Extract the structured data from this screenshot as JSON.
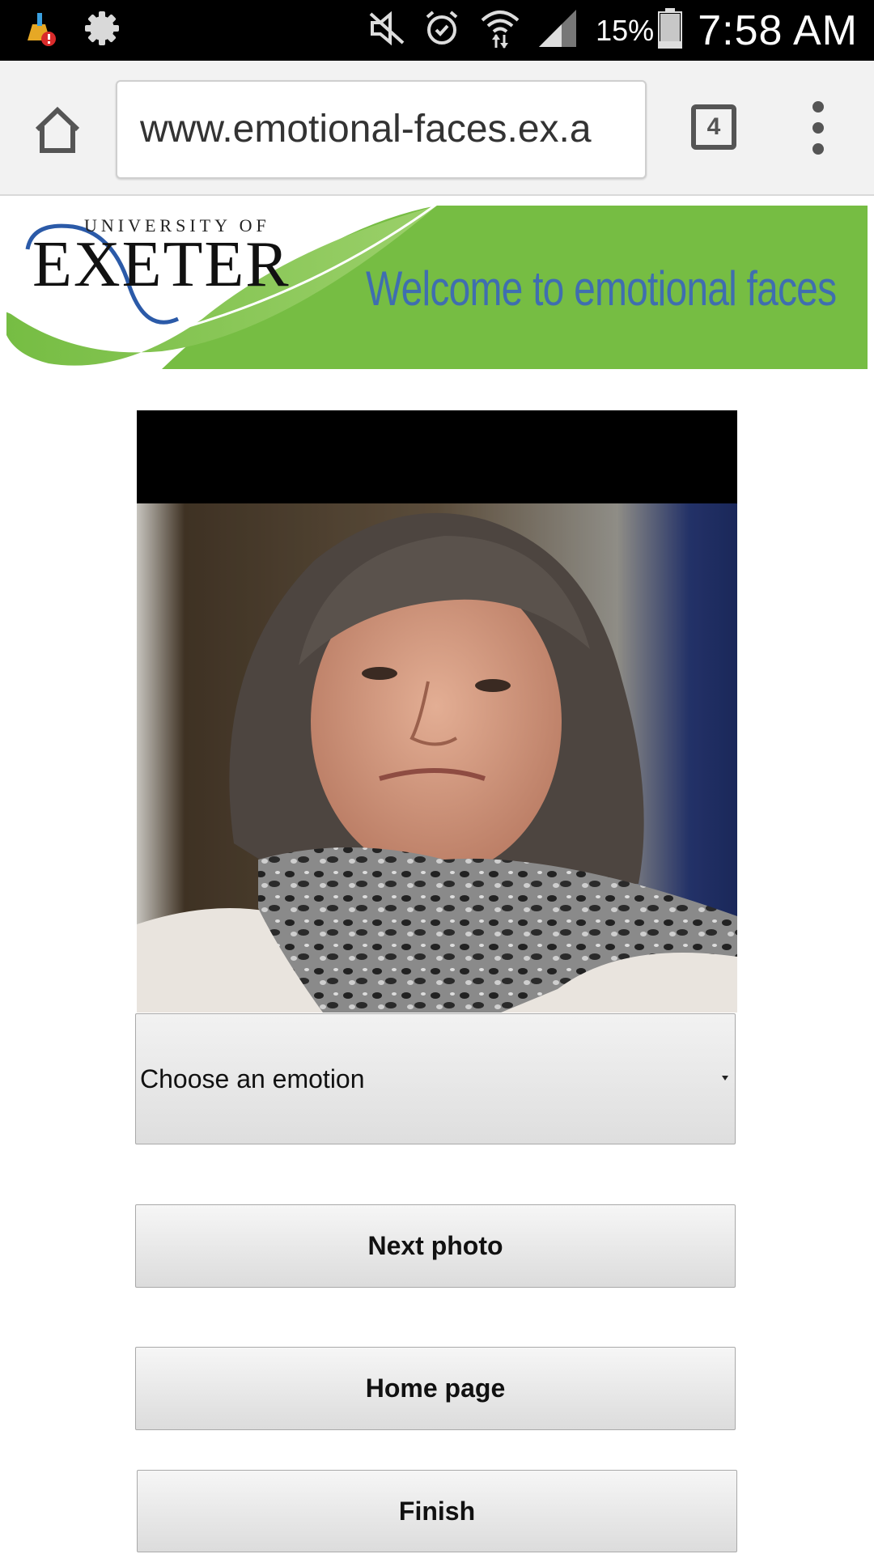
{
  "status_bar": {
    "icons": [
      "clean-master-broom-icon",
      "settings-gear-icon",
      "mute-icon",
      "alarm-icon",
      "wifi-icon",
      "signal-icon",
      "battery-icon"
    ],
    "battery_percent": "15%",
    "time": "7:58 AM"
  },
  "browser": {
    "url": "www.emotional-faces.ex.a",
    "tab_count": "4"
  },
  "header": {
    "logo_university_of": "UNIVERSITY OF",
    "logo_exeter": "EXETER",
    "welcome": "Welcome to emotional  faces"
  },
  "emotion_select": {
    "selected": "Choose an emotion"
  },
  "buttons": {
    "next_photo": "Next photo",
    "home_page": "Home page",
    "finish": "Finish"
  },
  "colors": {
    "banner_green": "#76bd43",
    "welcome_blue": "#3f6eb0",
    "logo_blue": "#2b5aa8"
  }
}
